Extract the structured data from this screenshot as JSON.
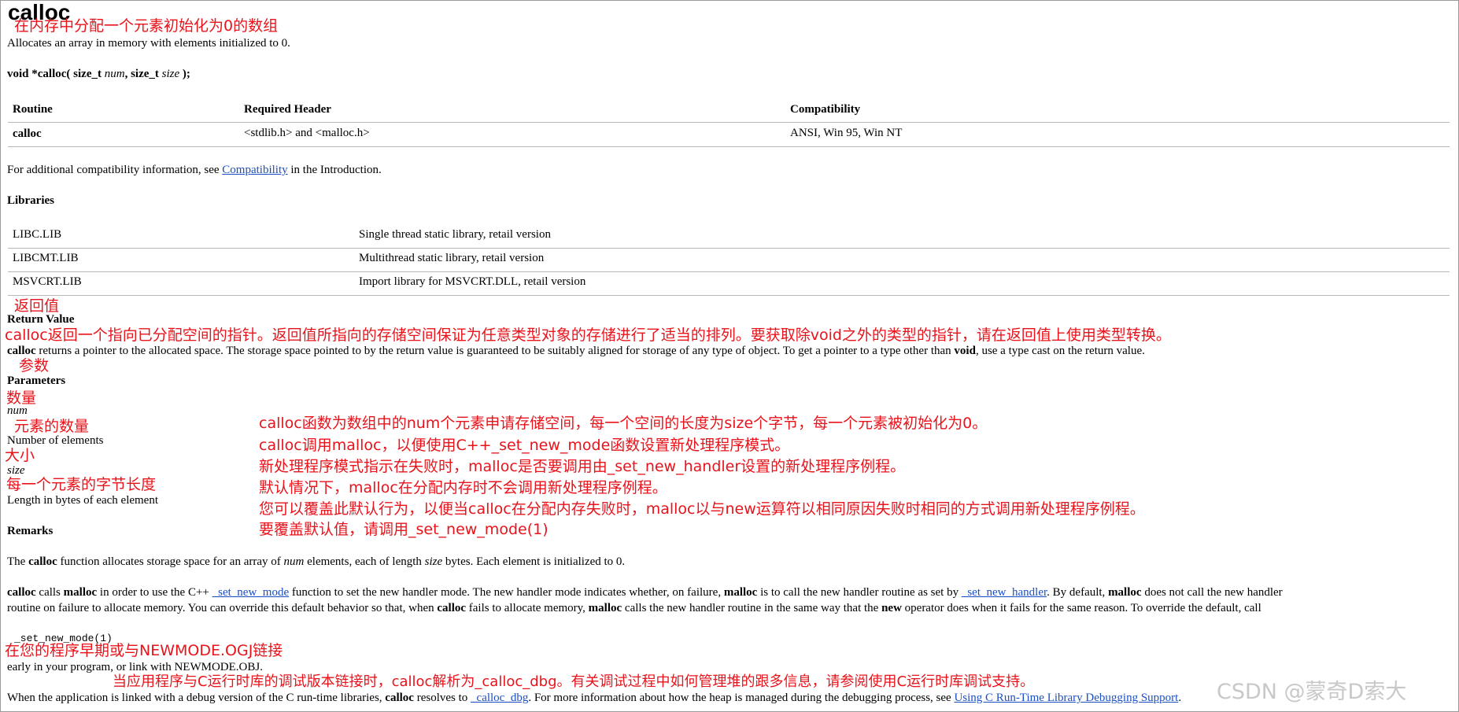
{
  "title": "calloc",
  "annotations": {
    "title_cn": "在内存中分配一个元素初始化为0的数组",
    "return_value_cn": "返回值",
    "return_desc_cn": "calloc返回一个指向已分配空间的指针。返回值所指向的存储空间保证为任意类型对象的存储进行了适当的排列。要获取除void之外的类型的指针，请在返回值上使用类型转换。",
    "parameters_cn": "参数",
    "num_cn": "数量",
    "num_desc_cn": "元素的数量",
    "size_cn": "大小",
    "size_desc_cn": "每一个元素的字节长度",
    "remarks_cn": [
      "calloc函数为数组中的num个元素申请存储空间，每一个空间的长度为size个字节，每一个元素被初始化为0。",
      "calloc调用malloc，以便使用C++_set_new_mode函数设置新处理程序模式。",
      "新处理程序模式指示在失败时，malloc是否要调用由_set_new_handler设置的新处理程序例程。",
      "默认情况下，malloc在分配内存时不会调用新处理程序例程。",
      "您可以覆盖此默认行为，以便当calloc在分配内存失败时，malloc以与new运算符以相同原因失败时相同的方式调用新处理程序例程。",
      "要覆盖默认值，请调用_set_new_mode(1)"
    ],
    "link_cn": "在您的程序早期或与NEWMODE.OGJ链接",
    "debug_cn": "当应用程序与C运行时库的调试版本链接时，calloc解析为_calloc_dbg。有关调试过程中如何管理堆的跟多信息，请参阅使用C运行时库调试支持。"
  },
  "subtitle": "Allocates an array in memory with elements initialized to 0.",
  "signature": {
    "prefix": "void *calloc( size_t ",
    "param1": "num",
    "mid": ", size_t ",
    "param2": "size",
    "suffix": " );"
  },
  "compat_table": {
    "headers": [
      "Routine",
      "Required Header",
      "Compatibility"
    ],
    "row": [
      "calloc",
      "<stdlib.h> and <malloc.h>",
      "ANSI, Win 95, Win NT"
    ]
  },
  "compat_note": {
    "before": "For additional compatibility information, see ",
    "link": "Compatibility",
    "after": " in the Introduction."
  },
  "libraries": {
    "heading": "Libraries",
    "rows": [
      [
        "LIBC.LIB",
        "Single thread static library, retail version"
      ],
      [
        "LIBCMT.LIB",
        "Multithread static library, retail version"
      ],
      [
        "MSVCRT.LIB",
        "Import library for MSVCRT.DLL, retail version"
      ]
    ]
  },
  "return_value": {
    "heading": "Return Value",
    "fn": "calloc",
    "text1": " returns a pointer to the allocated space. The storage space pointed to by the return value is guaranteed to be suitably aligned for storage of any type of object. To get a pointer to a type other than ",
    "kw": "void",
    "text2": ", use a type cast on the return value."
  },
  "parameters": {
    "heading": "Parameters",
    "num_name": "num",
    "num_desc": "Number of elements",
    "size_name": "size",
    "size_desc": "Length in bytes of each element"
  },
  "remarks": {
    "heading": "Remarks",
    "p1_a": "The ",
    "p1_fn": "calloc",
    "p1_b": " function allocates storage space for an array of ",
    "p1_num": "num",
    "p1_c": " elements, each of length ",
    "p1_size": "size",
    "p1_d": " bytes. Each element is initialized to 0.",
    "p2_fn": "calloc",
    "p2_a": " calls ",
    "p2_malloc": "malloc",
    "p2_b": " in order to use the C++ ",
    "p2_link1": "_set_new_mode",
    "p2_c": " function to set the new handler mode. The new handler mode indicates whether, on failure, ",
    "p2_malloc2": "malloc",
    "p2_d": " is to call the new handler routine as set by ",
    "p2_link2": "_set_new_handler",
    "p2_e": ". By default, ",
    "p2_malloc3": "malloc",
    "p2_f": " does not call the new handler",
    "p3_a": "routine on failure to allocate memory. You can override this default behavior so that, when ",
    "p3_fn": "calloc",
    "p3_b": " fails to allocate memory, ",
    "p3_malloc": "malloc",
    "p3_c": " calls the new handler routine in the same way that the ",
    "p3_new": "new",
    "p3_d": " operator does when it fails for the same reason. To override the default, call",
    "code": "_set_new_mode(1)",
    "p4": "early in your program, or link with NEWMODE.OBJ.",
    "p5_a": "When the application is linked with a debug version of the C run-time libraries, ",
    "p5_fn": "calloc",
    "p5_b": " resolves to ",
    "p5_link1": "_calloc_dbg",
    "p5_c": ". For more information about how the heap is managed during the debugging process, see ",
    "p5_link2": "Using C Run-Time Library Debugging Support",
    "p5_d": "."
  },
  "watermark": "CSDN @蒙奇D索大"
}
